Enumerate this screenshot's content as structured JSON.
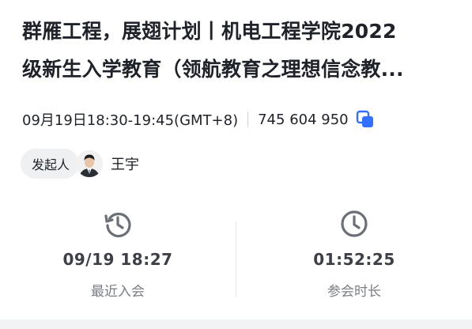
{
  "meeting": {
    "title_line1": "群雁工程，展翅计划丨机电工程学院2022",
    "title_line2": "级新生入学教育（领航教育之理想信念教...",
    "time": "09月19日18:30-19:45(GMT+8)",
    "meeting_id": "745 604 950",
    "copy_icon": "copy-icon"
  },
  "host": {
    "label": "发起人",
    "name": "王宇",
    "avatar_icon": "avatar"
  },
  "stats": {
    "recent_join": {
      "value": "09/19 18:27",
      "label": "最近入会",
      "icon": "history-clock-icon"
    },
    "duration": {
      "value": "01:52:25",
      "label": "参会时长",
      "icon": "clock-icon"
    }
  },
  "colors": {
    "accent": "#3370ff",
    "icon_gray": "#6b6f76",
    "text": "#1f2329",
    "muted": "#7a7e85"
  }
}
